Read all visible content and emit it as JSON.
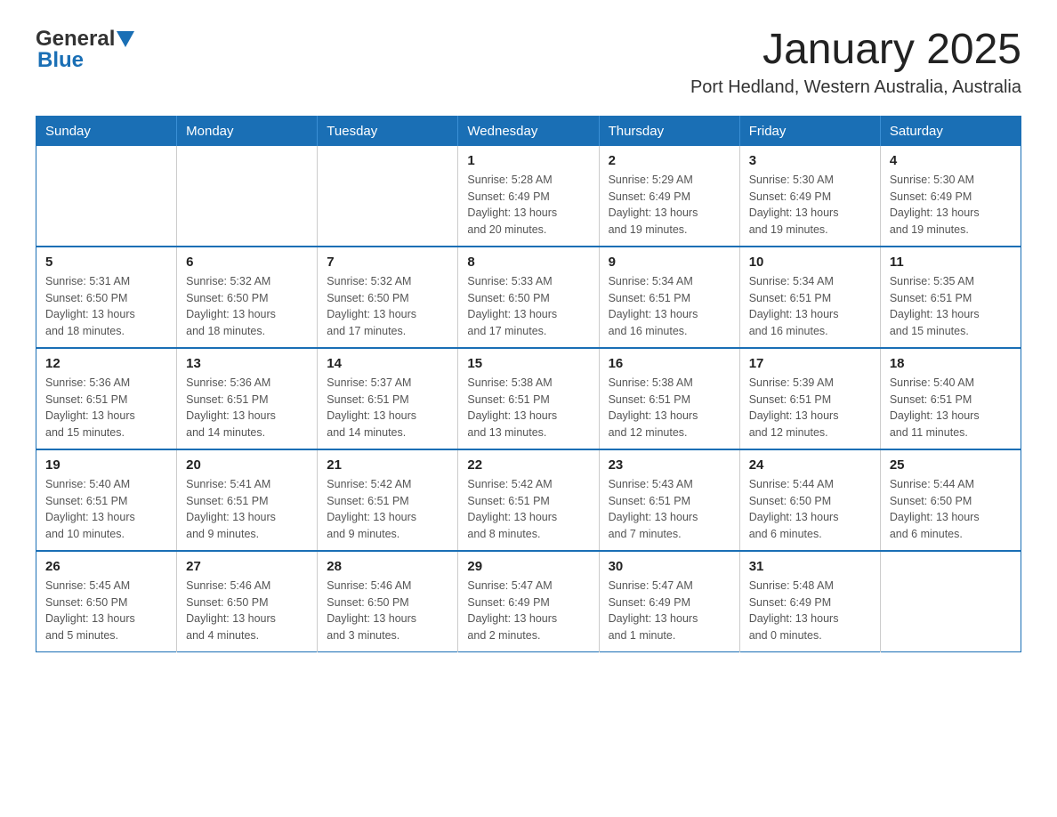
{
  "header": {
    "logo_general": "General",
    "logo_blue": "Blue",
    "month_title": "January 2025",
    "location": "Port Hedland, Western Australia, Australia"
  },
  "days_of_week": [
    "Sunday",
    "Monday",
    "Tuesday",
    "Wednesday",
    "Thursday",
    "Friday",
    "Saturday"
  ],
  "weeks": [
    [
      {
        "day": "",
        "info": ""
      },
      {
        "day": "",
        "info": ""
      },
      {
        "day": "",
        "info": ""
      },
      {
        "day": "1",
        "info": "Sunrise: 5:28 AM\nSunset: 6:49 PM\nDaylight: 13 hours\nand 20 minutes."
      },
      {
        "day": "2",
        "info": "Sunrise: 5:29 AM\nSunset: 6:49 PM\nDaylight: 13 hours\nand 19 minutes."
      },
      {
        "day": "3",
        "info": "Sunrise: 5:30 AM\nSunset: 6:49 PM\nDaylight: 13 hours\nand 19 minutes."
      },
      {
        "day": "4",
        "info": "Sunrise: 5:30 AM\nSunset: 6:49 PM\nDaylight: 13 hours\nand 19 minutes."
      }
    ],
    [
      {
        "day": "5",
        "info": "Sunrise: 5:31 AM\nSunset: 6:50 PM\nDaylight: 13 hours\nand 18 minutes."
      },
      {
        "day": "6",
        "info": "Sunrise: 5:32 AM\nSunset: 6:50 PM\nDaylight: 13 hours\nand 18 minutes."
      },
      {
        "day": "7",
        "info": "Sunrise: 5:32 AM\nSunset: 6:50 PM\nDaylight: 13 hours\nand 17 minutes."
      },
      {
        "day": "8",
        "info": "Sunrise: 5:33 AM\nSunset: 6:50 PM\nDaylight: 13 hours\nand 17 minutes."
      },
      {
        "day": "9",
        "info": "Sunrise: 5:34 AM\nSunset: 6:51 PM\nDaylight: 13 hours\nand 16 minutes."
      },
      {
        "day": "10",
        "info": "Sunrise: 5:34 AM\nSunset: 6:51 PM\nDaylight: 13 hours\nand 16 minutes."
      },
      {
        "day": "11",
        "info": "Sunrise: 5:35 AM\nSunset: 6:51 PM\nDaylight: 13 hours\nand 15 minutes."
      }
    ],
    [
      {
        "day": "12",
        "info": "Sunrise: 5:36 AM\nSunset: 6:51 PM\nDaylight: 13 hours\nand 15 minutes."
      },
      {
        "day": "13",
        "info": "Sunrise: 5:36 AM\nSunset: 6:51 PM\nDaylight: 13 hours\nand 14 minutes."
      },
      {
        "day": "14",
        "info": "Sunrise: 5:37 AM\nSunset: 6:51 PM\nDaylight: 13 hours\nand 14 minutes."
      },
      {
        "day": "15",
        "info": "Sunrise: 5:38 AM\nSunset: 6:51 PM\nDaylight: 13 hours\nand 13 minutes."
      },
      {
        "day": "16",
        "info": "Sunrise: 5:38 AM\nSunset: 6:51 PM\nDaylight: 13 hours\nand 12 minutes."
      },
      {
        "day": "17",
        "info": "Sunrise: 5:39 AM\nSunset: 6:51 PM\nDaylight: 13 hours\nand 12 minutes."
      },
      {
        "day": "18",
        "info": "Sunrise: 5:40 AM\nSunset: 6:51 PM\nDaylight: 13 hours\nand 11 minutes."
      }
    ],
    [
      {
        "day": "19",
        "info": "Sunrise: 5:40 AM\nSunset: 6:51 PM\nDaylight: 13 hours\nand 10 minutes."
      },
      {
        "day": "20",
        "info": "Sunrise: 5:41 AM\nSunset: 6:51 PM\nDaylight: 13 hours\nand 9 minutes."
      },
      {
        "day": "21",
        "info": "Sunrise: 5:42 AM\nSunset: 6:51 PM\nDaylight: 13 hours\nand 9 minutes."
      },
      {
        "day": "22",
        "info": "Sunrise: 5:42 AM\nSunset: 6:51 PM\nDaylight: 13 hours\nand 8 minutes."
      },
      {
        "day": "23",
        "info": "Sunrise: 5:43 AM\nSunset: 6:51 PM\nDaylight: 13 hours\nand 7 minutes."
      },
      {
        "day": "24",
        "info": "Sunrise: 5:44 AM\nSunset: 6:50 PM\nDaylight: 13 hours\nand 6 minutes."
      },
      {
        "day": "25",
        "info": "Sunrise: 5:44 AM\nSunset: 6:50 PM\nDaylight: 13 hours\nand 6 minutes."
      }
    ],
    [
      {
        "day": "26",
        "info": "Sunrise: 5:45 AM\nSunset: 6:50 PM\nDaylight: 13 hours\nand 5 minutes."
      },
      {
        "day": "27",
        "info": "Sunrise: 5:46 AM\nSunset: 6:50 PM\nDaylight: 13 hours\nand 4 minutes."
      },
      {
        "day": "28",
        "info": "Sunrise: 5:46 AM\nSunset: 6:50 PM\nDaylight: 13 hours\nand 3 minutes."
      },
      {
        "day": "29",
        "info": "Sunrise: 5:47 AM\nSunset: 6:49 PM\nDaylight: 13 hours\nand 2 minutes."
      },
      {
        "day": "30",
        "info": "Sunrise: 5:47 AM\nSunset: 6:49 PM\nDaylight: 13 hours\nand 1 minute."
      },
      {
        "day": "31",
        "info": "Sunrise: 5:48 AM\nSunset: 6:49 PM\nDaylight: 13 hours\nand 0 minutes."
      },
      {
        "day": "",
        "info": ""
      }
    ]
  ]
}
